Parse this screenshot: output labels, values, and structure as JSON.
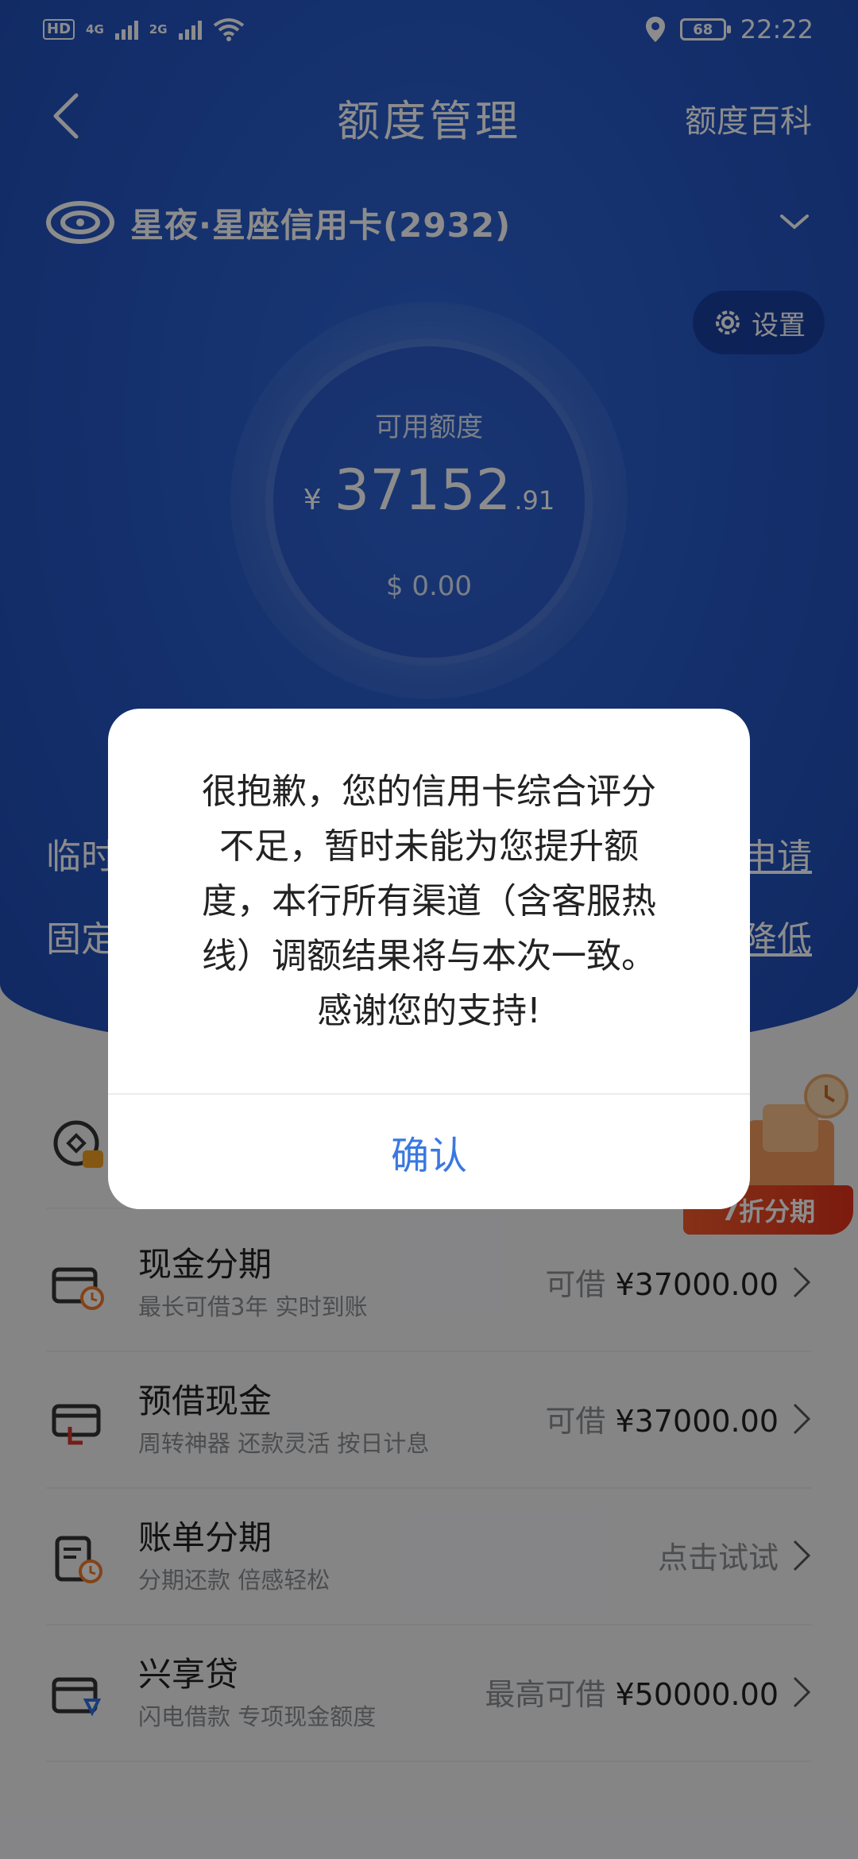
{
  "status_bar": {
    "hd": "HD",
    "net1": "4G",
    "net2": "2G",
    "battery": "68",
    "time": "22:22"
  },
  "header": {
    "title": "额度管理",
    "right_link": "额度百科"
  },
  "card": {
    "name": "星夜·星座信用卡(2932)"
  },
  "settings_label": "设置",
  "credit": {
    "label": "可用额度",
    "currency": "¥",
    "amount_int": "37152",
    "amount_dec": ".91",
    "usd": "$ 0.00"
  },
  "rows": {
    "temp_label": "临时",
    "temp_link": "申请",
    "fixed_label": "固定",
    "fixed_link": "降低"
  },
  "promo": {
    "tag": "7折分期"
  },
  "features": [
    {
      "title": "现金分期",
      "subtitle": "最长可借3年 实时到账",
      "right_prefix": "可借 ",
      "right_amount": "¥37000.00"
    },
    {
      "title": "预借现金",
      "subtitle": "周转神器 还款灵活 按日计息",
      "right_prefix": "可借 ",
      "right_amount": "¥37000.00"
    },
    {
      "title": "账单分期",
      "subtitle": "分期还款 倍感轻松",
      "right_prefix": "点击试试",
      "right_amount": ""
    },
    {
      "title": "兴享贷",
      "subtitle": "闪电借款 专项现金额度",
      "right_prefix": "最高可借 ",
      "right_amount": "¥50000.00"
    }
  ],
  "dialog": {
    "lines": [
      "很抱歉，您的信用卡综合评分",
      "不足，暂时未能为您提升额",
      "度，本行所有渠道（含客服热",
      "线）调额结果将与本次一致。",
      "感谢您的支持!"
    ],
    "confirm": "确认"
  },
  "colors": {
    "brand_blue": "#2556c4",
    "dialog_button": "#3a78e0",
    "promo_red": "#e0321b"
  }
}
